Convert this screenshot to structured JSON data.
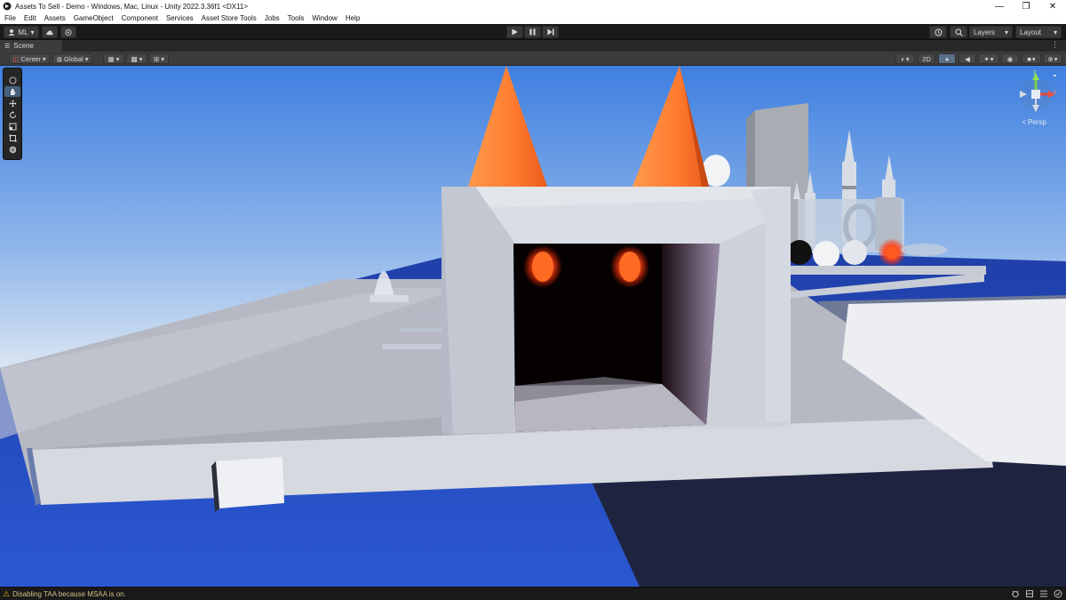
{
  "window": {
    "title": "Assets To Sell - Demo - Windows, Mac, Linux - Unity 2022.3.36f1 <DX11>",
    "minimize": "—",
    "restore": "❐",
    "close": "✕"
  },
  "menu": [
    "File",
    "Edit",
    "Assets",
    "GameObject",
    "Component",
    "Services",
    "Asset Store Tools",
    "Jobs",
    "Tools",
    "Window",
    "Help"
  ],
  "toolbar": {
    "account_label": "ML",
    "layers_label": "Layers",
    "layout_label": "Layout"
  },
  "scene_tab": {
    "label": "Scene"
  },
  "scene_toolbar": {
    "pivot_label": "Center",
    "space_label": "Global",
    "mode_2d_label": "2D"
  },
  "gizmo": {
    "y_label": "y",
    "x_label": "x",
    "projection_label": "< Persp"
  },
  "status": {
    "message": "Disabling TAA because MSAA is on."
  },
  "colors": {
    "sky_top": "#3f7fe0",
    "sky_bottom": "#e2ebf3",
    "ear_orange": "#ff7a30",
    "eye_red": "#ff5320",
    "floor_blue": "#2754c8",
    "warning": "#e8b31a"
  }
}
